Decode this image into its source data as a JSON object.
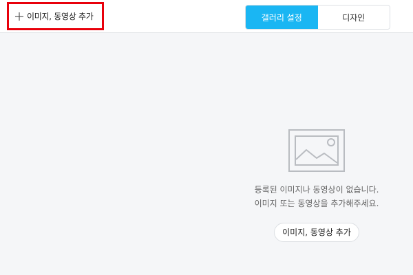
{
  "toolbar": {
    "add_media_label": "이미지, 동영상 추가",
    "add_media_icon": "plus-icon",
    "highlight_color": "#e8000b"
  },
  "tabs": [
    {
      "label": "갤러리 설정",
      "active": true
    },
    {
      "label": "디자인",
      "active": false
    }
  ],
  "accent_color": "#1ab6f3",
  "empty_state": {
    "icon": "image-placeholder-icon",
    "line1": "등록된 이미지나 동영상이 없습니다.",
    "line2": "이미지 또는 동영상을 추가해주세요.",
    "button_label": "이미지, 동영상 추가"
  }
}
